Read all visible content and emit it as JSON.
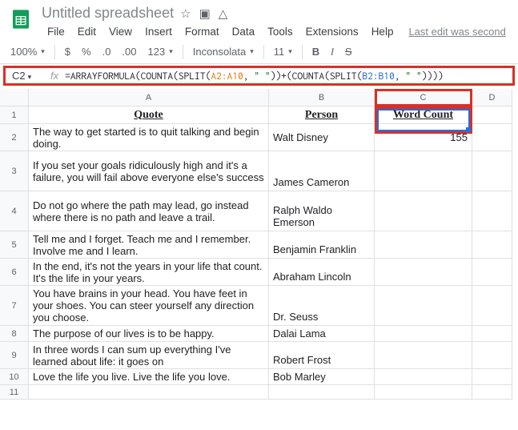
{
  "header": {
    "title": "Untitled spreadsheet",
    "icons": {
      "star": "☆",
      "move": "▣",
      "cloud": "△"
    },
    "last_edit": "Last edit was second"
  },
  "menu": [
    "File",
    "Edit",
    "View",
    "Insert",
    "Format",
    "Data",
    "Tools",
    "Extensions",
    "Help"
  ],
  "toolbar": {
    "zoom": "100%",
    "currency": "$",
    "percent": "%",
    "dec_dec": ".0",
    "dec_inc": ".00",
    "num": "123",
    "font": "Inconsolata",
    "size": "11",
    "bold": "B",
    "italic": "I",
    "strike": "S"
  },
  "formula": {
    "cell_ref": "C2",
    "fx": "fx",
    "pre": "=ARRAYFORMULA(COUNTA(SPLIT(",
    "r1": "A2:A10",
    "mid1": ", ",
    "s1": "\" \"",
    "mid2": "))+(COUNTA(SPLIT(",
    "r2": "B2:B10",
    "mid3": ", ",
    "s2": "\" \"",
    "post": "))))"
  },
  "columns": [
    "A",
    "B",
    "C",
    "D"
  ],
  "rownums": [
    "1",
    "2",
    "3",
    "4",
    "5",
    "6",
    "7",
    "8",
    "9",
    "10",
    "11"
  ],
  "headers": {
    "quote": "Quote",
    "person": "Person",
    "wc": "Word Count"
  },
  "data": [
    {
      "q": "The way to get started is to quit talking and begin doing.",
      "p": "Walt Disney",
      "wc": "155"
    },
    {
      "q": "If you set your goals ridiculously high and it's a failure, you will fail above everyone else's success",
      "p": "James Cameron",
      "wc": ""
    },
    {
      "q": "Do not go where the path may lead, go instead where there is no path and leave a trail.",
      "p": "Ralph Waldo Emerson",
      "wc": ""
    },
    {
      "q": "Tell me and I forget. Teach me and I remember. Involve me and I learn.",
      "p": "Benjamin Franklin",
      "wc": ""
    },
    {
      "q": "In the end, it's not the years in your life that count. It's the life in your years.",
      "p": "Abraham Lincoln",
      "wc": ""
    },
    {
      "q": "You have brains in your head. You have feet in your shoes. You can steer yourself any direction you choose.",
      "p": "Dr. Seuss",
      "wc": ""
    },
    {
      "q": "The purpose of our lives is to be happy.",
      "p": "Dalai Lama",
      "wc": ""
    },
    {
      "q": "In three words I can sum up everything I've learned about life: it goes on",
      "p": "Robert Frost",
      "wc": ""
    },
    {
      "q": "Love the life you live. Live the life you love.",
      "p": "Bob Marley",
      "wc": ""
    }
  ]
}
